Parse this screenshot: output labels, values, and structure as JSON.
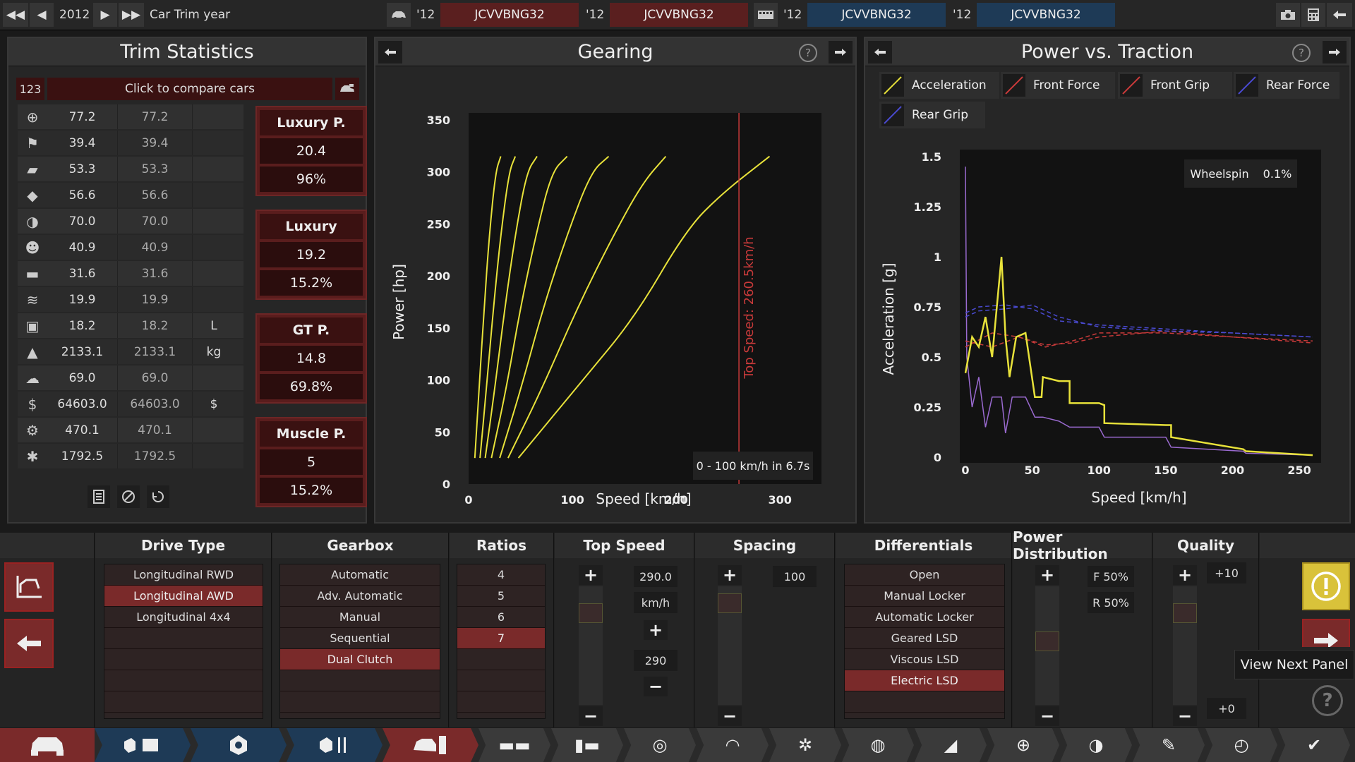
{
  "topbar": {
    "prev_fast": "◀◀",
    "prev": "◀",
    "year": "2012",
    "next": "▶",
    "next_fast": "▶▶",
    "label": "Car Trim year",
    "trims": [
      {
        "tag": "'12",
        "name": "JCVVBNG32",
        "color": "#5a1f1f"
      },
      {
        "tag": "'12",
        "name": "JCVVBNG32",
        "color": "#5a1f1f"
      },
      {
        "tag": "'12",
        "name": "JCVVBNG32",
        "color": "#1e3a56"
      },
      {
        "tag": "'12",
        "name": "JCVVBNG32",
        "color": "#1e3a56"
      }
    ]
  },
  "trim_stats": {
    "title": "Trim Statistics",
    "compare_num": "123",
    "compare_label": "Click to compare cars",
    "rows": [
      {
        "icon": "steering-wheel-icon",
        "glyph": "⊕",
        "a": "77.2",
        "b": "77.2",
        "unit": ""
      },
      {
        "icon": "race-flag-icon",
        "glyph": "⚑",
        "a": "39.4",
        "b": "39.4",
        "unit": ""
      },
      {
        "icon": "seat-icon",
        "glyph": "▰",
        "a": "53.3",
        "b": "53.3",
        "unit": ""
      },
      {
        "icon": "gem-icon",
        "glyph": "◆",
        "a": "56.6",
        "b": "56.6",
        "unit": ""
      },
      {
        "icon": "safety-icon",
        "glyph": "◑",
        "a": "70.0",
        "b": "70.0",
        "unit": ""
      },
      {
        "icon": "passengers-icon",
        "glyph": "☻",
        "a": "40.9",
        "b": "40.9",
        "unit": ""
      },
      {
        "icon": "cargo-car-icon",
        "glyph": "▬",
        "a": "31.6",
        "b": "31.6",
        "unit": ""
      },
      {
        "icon": "utility-car-icon",
        "glyph": "≋",
        "a": "19.9",
        "b": "19.9",
        "unit": ""
      },
      {
        "icon": "fuel-icon",
        "glyph": "▣",
        "a": "18.2",
        "b": "18.2",
        "unit": "L"
      },
      {
        "icon": "weight-icon",
        "glyph": "▲",
        "a": "2133.1",
        "b": "2133.1",
        "unit": "kg"
      },
      {
        "icon": "emissions-icon",
        "glyph": "☁",
        "a": "69.0",
        "b": "69.0",
        "unit": ""
      },
      {
        "icon": "cost-icon",
        "glyph": "$",
        "a": "64603.0",
        "b": "64603.0",
        "unit": "$"
      },
      {
        "icon": "service-icon",
        "glyph": "⚙",
        "a": "470.1",
        "b": "470.1",
        "unit": ""
      },
      {
        "icon": "engineering-time-icon",
        "glyph": "✱",
        "a": "1792.5",
        "b": "1792.5",
        "unit": ""
      }
    ],
    "categories": [
      {
        "name": "Luxury P.",
        "v1": "20.4",
        "v2": "96%"
      },
      {
        "name": "Luxury",
        "v1": "19.2",
        "v2": "15.2%"
      },
      {
        "name": "GT P.",
        "v1": "14.8",
        "v2": "69.8%"
      },
      {
        "name": "Muscle P.",
        "v1": "5",
        "v2": "15.2%"
      }
    ]
  },
  "gearing": {
    "title": "Gearing",
    "help": "?",
    "xlabel": "Speed [km/h]",
    "ylabel": "Power [hp]",
    "top_speed_label": "Top Speed: 260.5km/h",
    "accel_label": "0 - 100 km/h in 6.7s"
  },
  "traction": {
    "title": "Power vs. Traction",
    "help": "?",
    "xlabel": "Speed [km/h]",
    "ylabel": "Acceleration [g]",
    "wheelspin_label": "Wheelspin",
    "wheelspin_value": "0.1%",
    "legend": [
      {
        "name": "Acceleration",
        "color": "#e8e23a"
      },
      {
        "name": "Front Force",
        "color": "#c83a3a"
      },
      {
        "name": "Front Grip",
        "color": "#c83a3a"
      },
      {
        "name": "Rear Force",
        "color": "#4a4ad0"
      },
      {
        "name": "Rear Grip",
        "color": "#4a4ad0"
      }
    ]
  },
  "chart_data": [
    {
      "type": "line",
      "title": "Gearing",
      "xlabel": "Speed [km/h]",
      "ylabel": "Power [hp]",
      "xlim": [
        0,
        340
      ],
      "ylim": [
        0,
        350
      ],
      "xticks": [
        0,
        100,
        200,
        300
      ],
      "yticks": [
        0,
        50,
        100,
        150,
        200,
        250,
        300,
        350
      ],
      "top_speed": 260.5,
      "series": [
        {
          "x": [
            6,
            10,
            15,
            20,
            26,
            31
          ],
          "y": [
            25,
            90,
            170,
            240,
            300,
            315
          ]
        },
        {
          "x": [
            11,
            17,
            24,
            31,
            39,
            45
          ],
          "y": [
            25,
            90,
            170,
            240,
            300,
            315
          ]
        },
        {
          "x": [
            16,
            25,
            35,
            45,
            56,
            66
          ],
          "y": [
            25,
            90,
            170,
            240,
            300,
            315
          ]
        },
        {
          "x": [
            22,
            36,
            50,
            65,
            80,
            95
          ],
          "y": [
            25,
            90,
            170,
            240,
            300,
            315
          ]
        },
        {
          "x": [
            30,
            50,
            72,
            95,
            118,
            135
          ],
          "y": [
            25,
            90,
            170,
            240,
            300,
            315
          ]
        },
        {
          "x": [
            38,
            70,
            105,
            140,
            168,
            190
          ],
          "y": [
            25,
            90,
            170,
            240,
            290,
            315
          ]
        },
        {
          "x": [
            48,
            110,
            160,
            210,
            245,
            290
          ],
          "y": [
            25,
            100,
            160,
            245,
            280,
            315
          ]
        }
      ]
    },
    {
      "type": "line",
      "title": "Power vs. Traction",
      "xlabel": "Speed [km/h]",
      "ylabel": "Acceleration [g]",
      "xlim": [
        0,
        260
      ],
      "ylim": [
        0,
        1.5
      ],
      "xticks": [
        0,
        50,
        100,
        150,
        200,
        250
      ],
      "yticks": [
        0,
        0.25,
        0.5,
        0.75,
        1,
        1.25,
        1.5
      ],
      "series": [
        {
          "name": "Acceleration",
          "x": [
            0,
            5,
            10,
            15,
            20,
            27,
            30,
            33,
            38,
            45,
            52,
            57,
            58,
            70,
            78,
            78,
            100,
            104,
            104,
            150,
            154,
            154,
            208,
            210,
            260
          ],
          "y": [
            0.42,
            0.6,
            0.55,
            0.7,
            0.5,
            1.0,
            0.6,
            0.4,
            0.6,
            0.62,
            0.3,
            0.3,
            0.4,
            0.38,
            0.38,
            0.27,
            0.27,
            0.26,
            0.17,
            0.16,
            0.16,
            0.1,
            0.04,
            0.03,
            0.01
          ]
        },
        {
          "name": "Front Force",
          "x": [
            0,
            20,
            40,
            60,
            80,
            100,
            150,
            200,
            260
          ],
          "y": [
            0.58,
            0.55,
            0.6,
            0.56,
            0.57,
            0.6,
            0.63,
            0.6,
            0.57
          ]
        },
        {
          "name": "Front Grip",
          "x": [
            0,
            20,
            40,
            60,
            80,
            100,
            150,
            200,
            260
          ],
          "y": [
            0.55,
            0.62,
            0.6,
            0.55,
            0.58,
            0.62,
            0.62,
            0.6,
            0.58
          ]
        },
        {
          "name": "Rear Force",
          "x": [
            0,
            10,
            30,
            50,
            70,
            100,
            150,
            200,
            260
          ],
          "y": [
            0.72,
            0.75,
            0.76,
            0.74,
            0.68,
            0.66,
            0.64,
            0.62,
            0.6
          ]
        },
        {
          "name": "Rear Grip",
          "x": [
            0,
            10,
            30,
            50,
            70,
            100,
            150,
            200,
            260
          ],
          "y": [
            0.7,
            0.73,
            0.74,
            0.76,
            0.7,
            0.65,
            0.63,
            0.62,
            0.6
          ]
        },
        {
          "name": "Wheelspin trace",
          "x": [
            0,
            1,
            5,
            10,
            15,
            20,
            27,
            30,
            35,
            45,
            52,
            58,
            70,
            78,
            100,
            104,
            150,
            154,
            208,
            210,
            260
          ],
          "y": [
            1.45,
            0.5,
            0.25,
            0.4,
            0.15,
            0.3,
            0.3,
            0.12,
            0.3,
            0.3,
            0.2,
            0.2,
            0.18,
            0.15,
            0.15,
            0.1,
            0.1,
            0.05,
            0.03,
            0.02,
            0.01
          ]
        }
      ]
    }
  ],
  "bottom": {
    "drive_type": {
      "title": "Drive Type",
      "options": [
        "Longitudinal RWD",
        "Longitudinal AWD",
        "Longitudinal 4x4"
      ],
      "selected": 1
    },
    "gearbox": {
      "title": "Gearbox",
      "options": [
        "Automatic",
        "Adv. Automatic",
        "Manual",
        "Sequential",
        "Dual Clutch"
      ],
      "selected": 4
    },
    "ratios": {
      "title": "Ratios",
      "options": [
        "4",
        "5",
        "6",
        "7"
      ],
      "selected": 3
    },
    "top_speed": {
      "title": "Top Speed",
      "value": "290.0",
      "unit": "km/h",
      "target": "290"
    },
    "spacing": {
      "title": "Spacing",
      "value": "100"
    },
    "differentials": {
      "title": "Differentials",
      "options": [
        "Open",
        "Manual Locker",
        "Automatic Locker",
        "Geared LSD",
        "Viscous LSD",
        "Electric LSD"
      ],
      "selected": 5
    },
    "power_distribution": {
      "title": "Power Distribution",
      "front": "F 50%",
      "rear": "R 50%"
    },
    "quality": {
      "title": "Quality",
      "top": "+10",
      "bottom": "+0"
    },
    "tooltip": "View Next Panel"
  },
  "colors": {
    "accent_red": "#7a2a2a",
    "trim_red": "#5a1f1f",
    "trim_blue": "#1e3a56",
    "accel": "#e8e23a"
  }
}
